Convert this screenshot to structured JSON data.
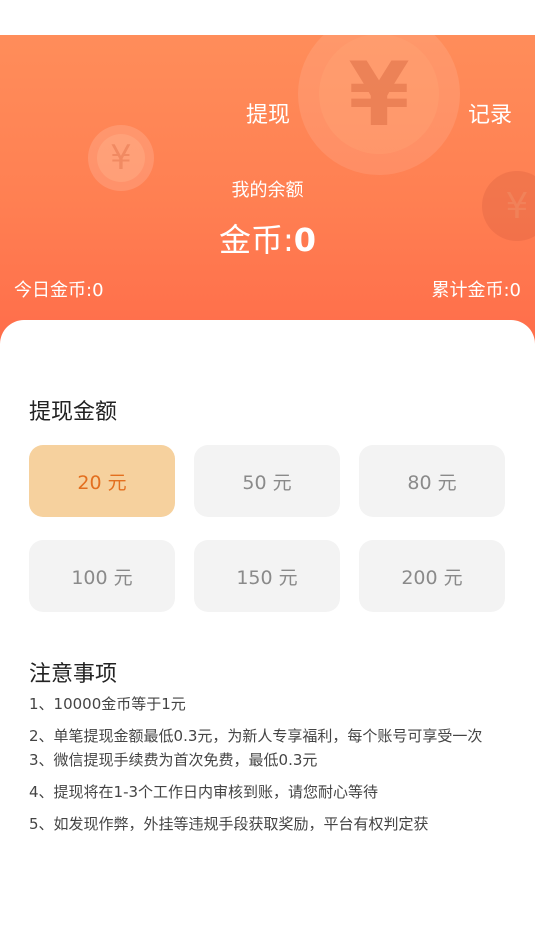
{
  "header": {
    "title": "提现",
    "record_label": "记录",
    "coin_symbol": "¥",
    "balance_label": "我的余额",
    "balance_prefix": "金币:",
    "balance_value": "0",
    "today_coins": "今日金币:0",
    "total_coins": "累计金币:0"
  },
  "withdraw": {
    "section_title": "提现金额",
    "options": [
      "20 元",
      "50 元",
      "80 元",
      "100 元",
      "150 元",
      "200 元"
    ],
    "selected": "20 元"
  },
  "notes": {
    "section_title": "注意事项",
    "items": [
      "1、10000金币等于1元",
      "2、单笔提现金额最低0.3元，为新人专享福利，每个账号可享受一次",
      "3、微信提现手续费为首次免费，最低0.3元",
      "4、提现将在1-3个工作日内审核到账，请您耐心等待",
      "5、如发现作弊，外挂等违规手段获取奖励，平台有权判定获"
    ]
  },
  "colors": {
    "header_top": "#ff8d5a",
    "header_bottom": "#ff6d4a",
    "selected_bg": "#f6d19e",
    "selected_text": "#e36f1f",
    "option_bg": "#f3f3f3"
  }
}
